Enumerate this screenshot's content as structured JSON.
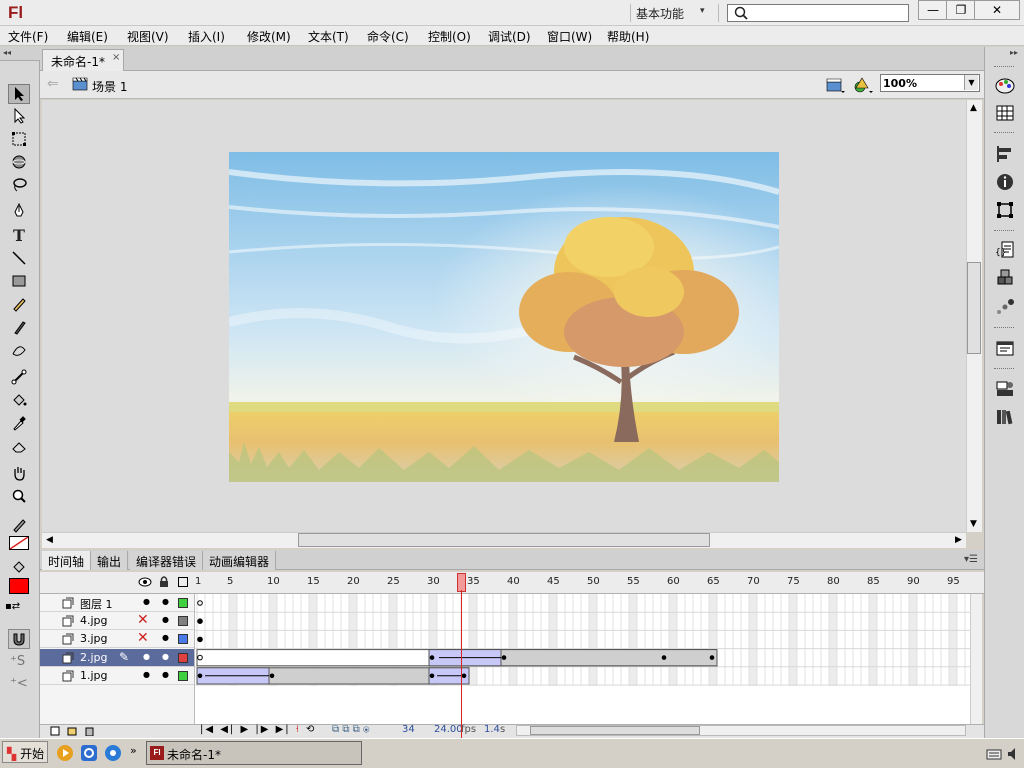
{
  "titlebar": {
    "app_logo": "Fl",
    "workspace": "基本功能",
    "search_placeholder": "",
    "minimize": "—",
    "maximize": "❐",
    "close": "✕"
  },
  "menu": [
    "文件(F)",
    "编辑(E)",
    "视图(V)",
    "插入(I)",
    "修改(M)",
    "文本(T)",
    "命令(C)",
    "控制(O)",
    "调试(D)",
    "窗口(W)",
    "帮助(H)"
  ],
  "document": {
    "tab_title": "未命名-1*",
    "tab_close": "×",
    "scene_label": "场景 1",
    "zoom": "100%"
  },
  "timeline": {
    "tabs": [
      "时间轴",
      "输出",
      "编译器错误",
      "动画编辑器"
    ],
    "ruler": [
      "1",
      "5",
      "10",
      "15",
      "20",
      "25",
      "30",
      "35",
      "40",
      "45",
      "50",
      "55",
      "60",
      "65",
      "70",
      "75",
      "80",
      "85",
      "90",
      "95"
    ],
    "layers": [
      {
        "name": "图层 1",
        "color": "#3fcf3f",
        "selected": false,
        "hidden_mark": false
      },
      {
        "name": "4.jpg",
        "color": "#808080",
        "selected": false,
        "hidden_mark": true
      },
      {
        "name": "3.jpg",
        "color": "#4a7ae8",
        "selected": false,
        "hidden_mark": true
      },
      {
        "name": "2.jpg",
        "color": "#e04040",
        "selected": true,
        "hidden_mark": false
      },
      {
        "name": "1.jpg",
        "color": "#3fcf3f",
        "selected": false,
        "hidden_mark": false
      }
    ],
    "current_frame": "34",
    "fps": "24.00",
    "fps_unit": "fps",
    "elapsed": "1.4",
    "elapsed_unit": "s"
  },
  "taskbar": {
    "start": "开始",
    "task_item": "未命名-1*"
  },
  "colors": {
    "accent_red": "#d22222",
    "selected_layer": "#5b6b9c",
    "tween_fill": "#c8c8f8"
  }
}
